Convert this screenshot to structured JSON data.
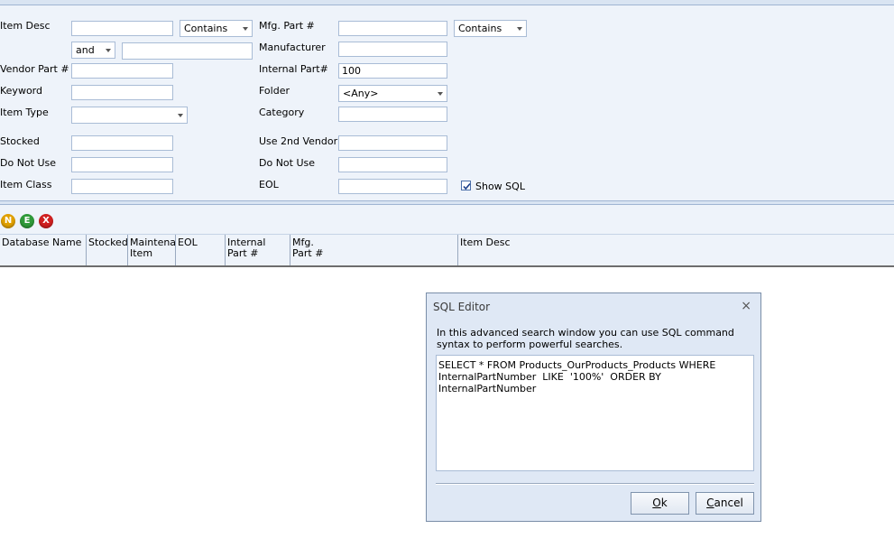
{
  "search": {
    "item_desc_label": "Item Desc",
    "item_desc_value": "",
    "item_desc_match": "Contains",
    "and_operator": "and",
    "item_desc_value2": "",
    "vendor_part_label": "Vendor Part #",
    "vendor_part_value": "",
    "keyword_label": "Keyword",
    "keyword_value": "",
    "item_type_label": "Item Type",
    "item_type_value": "",
    "stocked_label": "Stocked",
    "stocked_value": "",
    "do_not_use_label": "Do Not Use",
    "do_not_use_value": "",
    "item_class_label": "Item Class",
    "item_class_value": "",
    "mfg_part_label": "Mfg. Part #",
    "mfg_part_value": "",
    "mfg_part_match": "Contains",
    "manufacturer_label": "Manufacturer",
    "manufacturer_value": "",
    "internal_part_label": "Internal Part#",
    "internal_part_value": "100",
    "folder_label": "Folder",
    "folder_value": "<Any>",
    "category_label": "Category",
    "category_value": "",
    "use_2nd_vendor_label": "Use 2nd Vendor?",
    "use_2nd_vendor_value": "",
    "do_not_use2_label": "Do Not Use",
    "do_not_use2_value": "",
    "eol_label": "EOL",
    "eol_value": "",
    "show_sql_label": "Show SQL",
    "show_sql_checked": true
  },
  "toolbar": {
    "new_label": "N",
    "edit_label": "E",
    "delete_label": "X",
    "new_color": "#e0a000",
    "edit_color": "#2f9a3a",
    "delete_color": "#d02020"
  },
  "grid": {
    "columns": [
      "Database Name",
      "Stocked",
      "Maintenar\nItem",
      "EOL",
      "Internal\nPart #",
      "Mfg.\nPart #",
      "Item Desc"
    ]
  },
  "sql_editor": {
    "title": "SQL Editor",
    "close_glyph": "×",
    "description": "In this advanced search window you can use SQL command syntax to perform powerful searches.",
    "query": "SELECT * FROM Products_OurProducts_Products WHERE InternalPartNumber  LIKE  '100%'  ORDER BY InternalPartNumber",
    "ok_mnemonic": "O",
    "ok_rest": "k",
    "cancel_mnemonic": "C",
    "cancel_rest": "ancel"
  }
}
